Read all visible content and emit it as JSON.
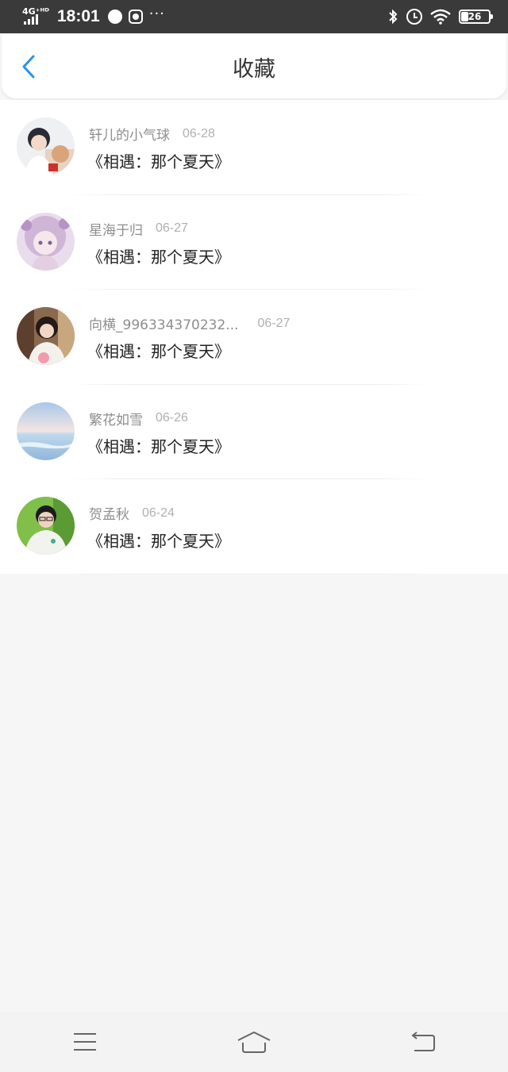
{
  "status_bar": {
    "network": "4G⁺ᴴᴰ",
    "time": "18:01",
    "more": "···",
    "battery": "26"
  },
  "header": {
    "title": "收藏",
    "accent_color": "#2b93e8"
  },
  "favorites": [
    {
      "name": "轩儿的小气球",
      "date": "06-28",
      "title": "《相遇：那个夏天》"
    },
    {
      "name": "星海于归",
      "date": "06-27",
      "title": "《相遇：那个夏天》"
    },
    {
      "name": "向横_996334370232...",
      "date": "06-27",
      "title": "《相遇：那个夏天》"
    },
    {
      "name": "繁花如雪",
      "date": "06-26",
      "title": "《相遇：那个夏天》"
    },
    {
      "name": "贺孟秋",
      "date": "06-24",
      "title": "《相遇：那个夏天》"
    }
  ],
  "nav_icons": [
    "menu-icon",
    "home-icon",
    "back-icon"
  ]
}
